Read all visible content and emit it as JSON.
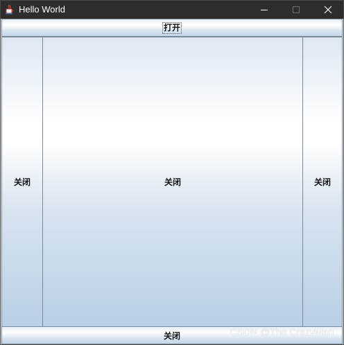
{
  "window": {
    "title": "Hello World",
    "icon": "java-cup-icon",
    "controls": {
      "minimize": "minimize-icon",
      "maximize": "maximize-icon",
      "close": "close-icon"
    }
  },
  "buttons": {
    "north": "打开",
    "west": "关闭",
    "center": "关闭",
    "east": "关闭",
    "south": "关闭"
  },
  "watermark": "CSDN @The CrazyMan",
  "colors": {
    "titlebar": "#2d2d2d",
    "button_border": "#7a8a99",
    "gradient_top": "#dde8f3",
    "gradient_mid": "#ffffff",
    "gradient_bottom": "#b9cfe5"
  }
}
